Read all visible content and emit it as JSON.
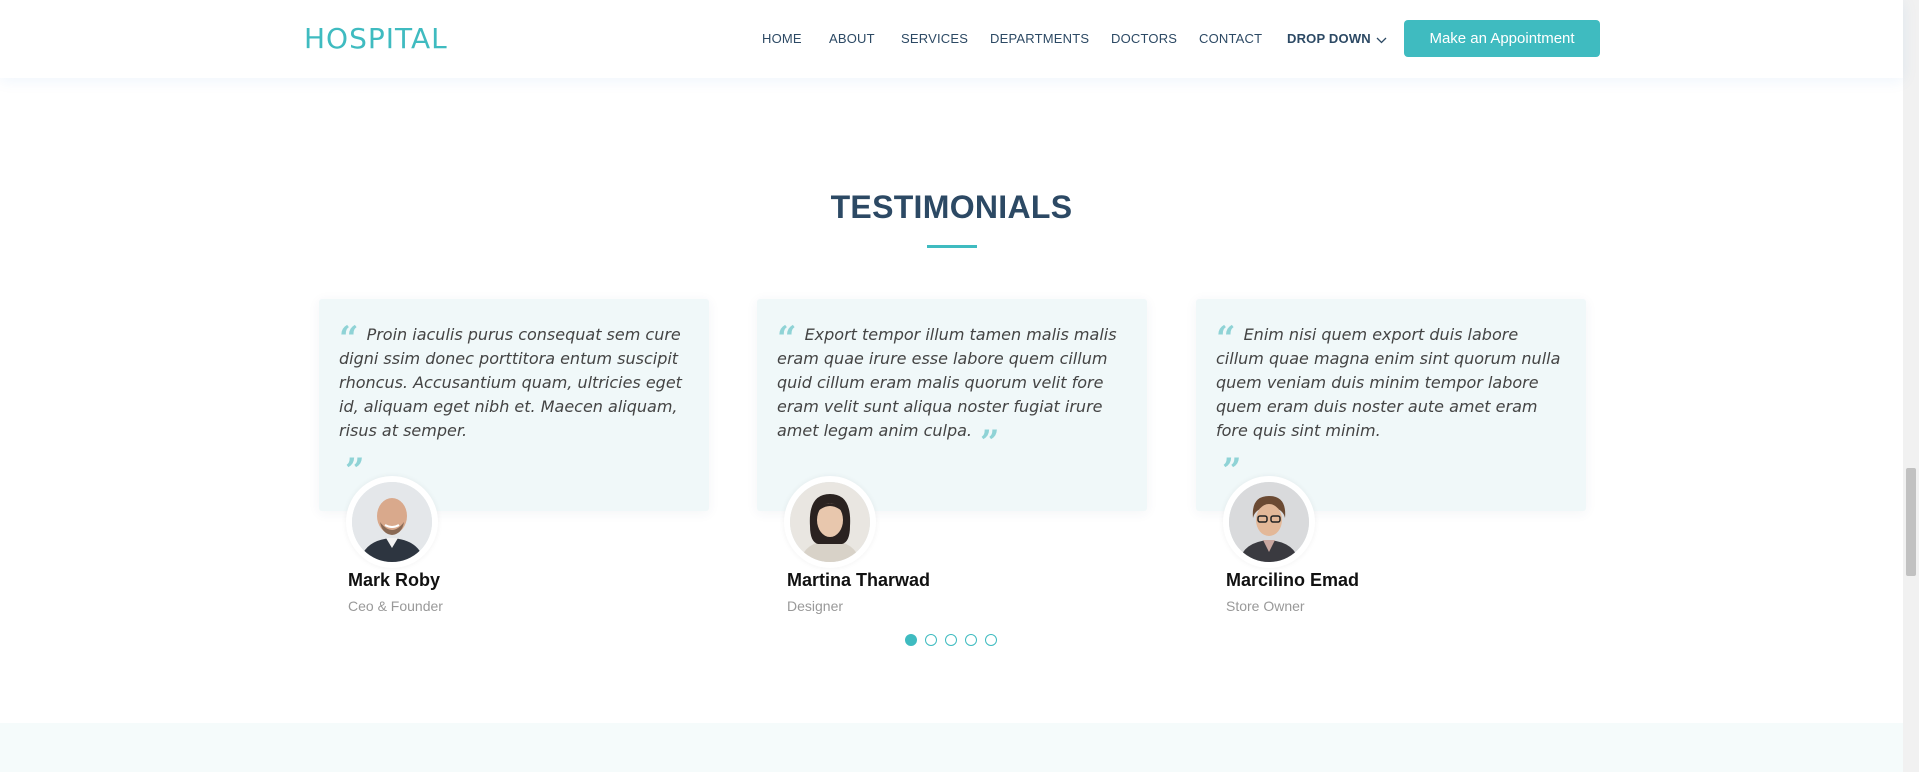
{
  "header": {
    "logo": "HOSPITAL",
    "nav": [
      {
        "label": "HOME"
      },
      {
        "label": "ABOUT"
      },
      {
        "label": "SERVICES"
      },
      {
        "label": "DEPARTMENTS"
      },
      {
        "label": "DOCTORS"
      },
      {
        "label": "CONTACT"
      },
      {
        "label": "DROP DOWN",
        "icon": "chevron-down-icon"
      }
    ],
    "cta": "Make an Appointment"
  },
  "testimonials": {
    "title": "TESTIMONIALS",
    "items": [
      {
        "quote": "Proin iaculis purus consequat sem cure digni ssim donec porttitora entum suscipit rhoncus. Accusantium quam, ultricies eget id, aliquam eget nibh et. Maecen aliquam, risus at semper.",
        "name": "Mark Roby",
        "role": "Ceo & Founder"
      },
      {
        "quote": "Export tempor illum tamen malis malis eram quae irure esse labore quem cillum quid cillum eram malis quorum velit fore eram velit sunt aliqua noster fugiat irure amet legam anim culpa.",
        "name": "Martina Tharwad",
        "role": "Designer"
      },
      {
        "quote": "Enim nisi quem export duis labore cillum quae magna enim sint quorum nulla quem veniam duis minim tempor labore quem eram duis noster aute amet eram fore quis sint minim.",
        "name": "Marcilino Emad",
        "role": "Store Owner"
      }
    ],
    "pagination": {
      "total": 5,
      "active": 1
    }
  },
  "colors": {
    "accent": "#3fbbc0",
    "heading": "#2c4964",
    "card_bg": "#f0f8f9"
  }
}
